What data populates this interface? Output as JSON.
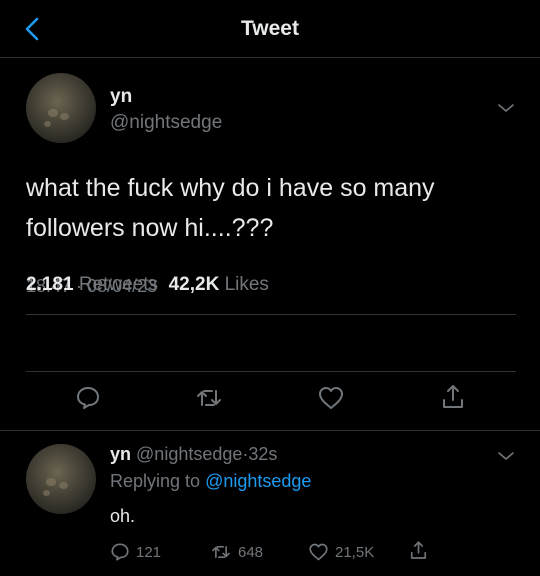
{
  "header": {
    "title": "Tweet"
  },
  "tweet": {
    "name": "yn",
    "handle": "@nightsedge",
    "text_line1": "what the fuck why do i have so many",
    "text_line2": "followers now hi....???",
    "timestamp": "18.47 · 08/04/23",
    "retweets_count": "2.181",
    "retweets_label": "Retweets",
    "likes_count": "42,2K",
    "likes_label": "Likes"
  },
  "reply": {
    "name": "yn",
    "handle": "@nightsedge",
    "separator": "·",
    "time": "32s",
    "replying_prefix": "Replying to",
    "replying_to": "@nightsedge",
    "text": "oh.",
    "reply_count": "121",
    "retweet_count": "648",
    "like_count": "21,5K"
  },
  "colors": {
    "background": "#000000",
    "text": "#e7e9ea",
    "muted": "#71767b",
    "accent": "#1d9bf0",
    "divider": "#2f3336"
  },
  "icons": [
    "back-icon",
    "chevron-down-icon",
    "reply-icon",
    "retweet-icon",
    "like-icon",
    "share-icon"
  ]
}
